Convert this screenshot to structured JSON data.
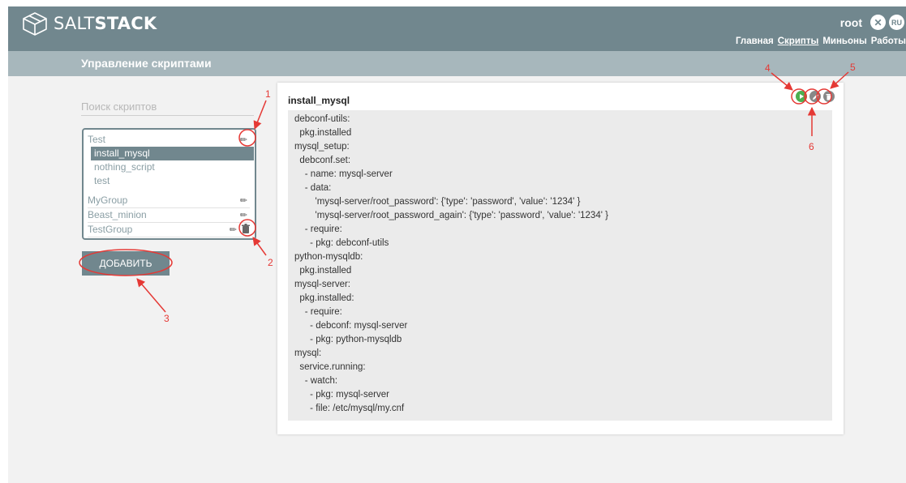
{
  "header": {
    "brand_regular": "SALT",
    "brand_bold": "STACK",
    "username": "root",
    "close_glyph": "✕",
    "lang": "RU",
    "nav": [
      {
        "label": "Главная",
        "active": false
      },
      {
        "label": "Скрипты",
        "active": true
      },
      {
        "label": "Миньоны",
        "active": false
      },
      {
        "label": "Работы",
        "active": false
      }
    ]
  },
  "page": {
    "subtitle": "Управление скриптами"
  },
  "sidebar": {
    "search_placeholder": "Поиск скриптов",
    "groups": [
      {
        "name": "Test",
        "scripts": [
          "install_mysql",
          "nothing_script",
          "test"
        ],
        "selected": "install_mysql"
      },
      {
        "name": "MyGroup"
      },
      {
        "name": "Beast_minion"
      },
      {
        "name": "TestGroup"
      }
    ],
    "add_label": "ДОБАВИТЬ"
  },
  "script": {
    "name": "install_mysql",
    "content": "debconf-utils:\n  pkg.installed\nmysql_setup:\n  debconf.set:\n    - name: mysql-server\n    - data:\n        'mysql-server/root_password': {'type': 'password', 'value': '1234' }\n        'mysql-server/root_password_again': {'type': 'password', 'value': '1234' }\n    - require:\n      - pkg: debconf-utils\npython-mysqldb:\n  pkg.installed\nmysql-server:\n  pkg.installed:\n    - require:\n      - debconf: mysql-server\n      - pkg: python-mysqldb\nmysql:\n  service.running:\n    - watch:\n      - pkg: mysql-server\n      - file: /etc/mysql/my.cnf"
  },
  "annotations": [
    "1",
    "2",
    "3",
    "4",
    "5",
    "6"
  ],
  "colors": {
    "header": "#71878e",
    "subheader": "#a7b7bc",
    "annotation": "#e53935",
    "run": "#4caf50"
  },
  "icons": [
    "cube-logo-icon",
    "close-icon",
    "pencil-icon",
    "trash-icon",
    "play-icon"
  ]
}
